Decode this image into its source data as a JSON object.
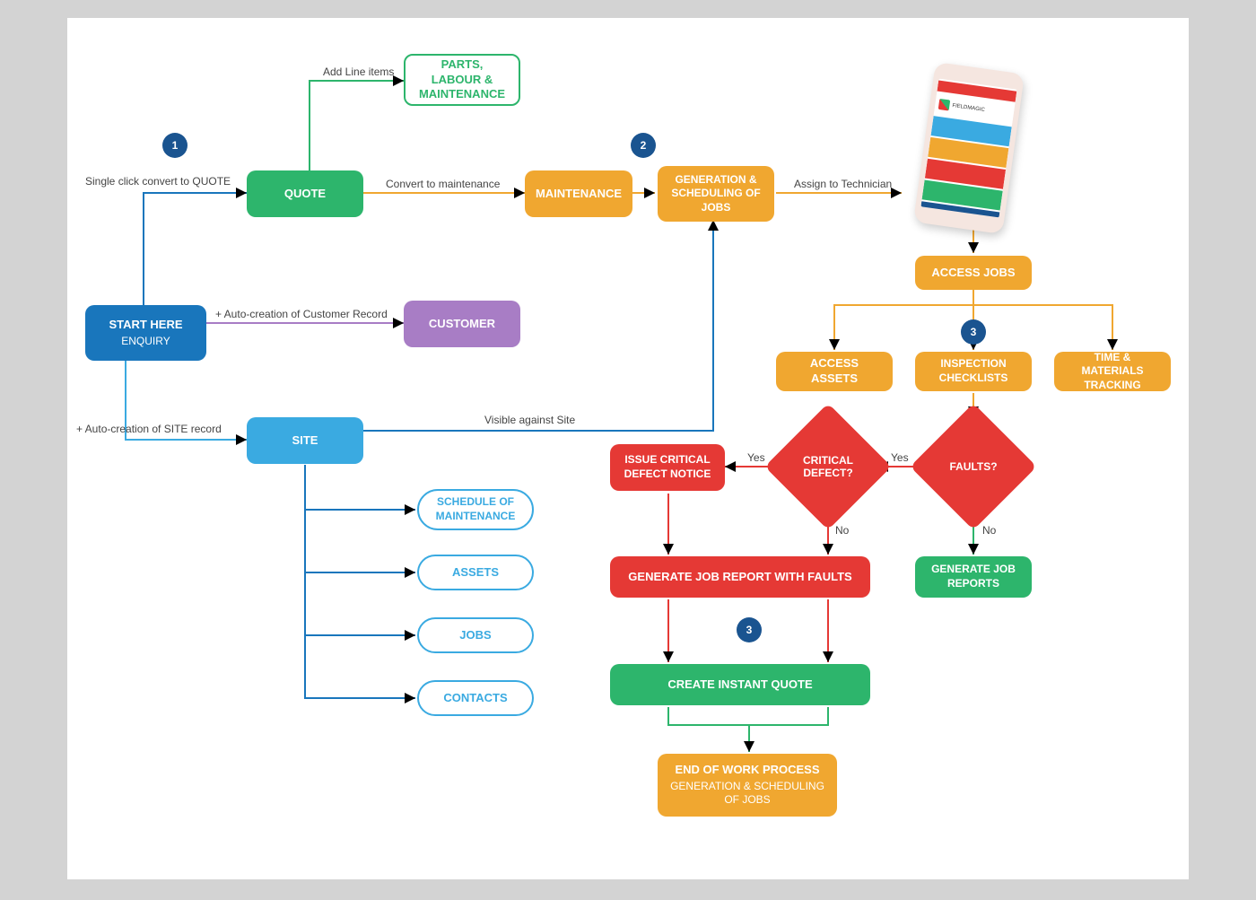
{
  "nodes": {
    "start": {
      "title": "START HERE",
      "subtitle": "ENQUIRY"
    },
    "quote": {
      "title": "QUOTE"
    },
    "parts": {
      "title": "PARTS, LABOUR & MAINTENANCE"
    },
    "maintenance": {
      "title": "MAINTENANCE"
    },
    "generation": {
      "title": "GENERATION & SCHEDULING OF JOBS"
    },
    "customer": {
      "title": "CUSTOMER"
    },
    "site": {
      "title": "SITE"
    },
    "schedule_maintenance": {
      "title": "SCHEDULE OF MAINTENANCE"
    },
    "assets": {
      "title": "ASSETS"
    },
    "jobs": {
      "title": "JOBS"
    },
    "contacts": {
      "title": "CONTACTS"
    },
    "access_jobs": {
      "title": "ACCESS JOBS"
    },
    "access_assets": {
      "title": "ACCESS ASSETS"
    },
    "inspection": {
      "title": "INSPECTION CHECKLISTS"
    },
    "time_materials": {
      "title": "TIME & MATERIALS TRACKING"
    },
    "faults": {
      "title": "FAULTS?"
    },
    "critical_defect": {
      "title": "CRITICAL DEFECT?"
    },
    "issue_notice": {
      "title": "ISSUE CRITICAL DEFECT NOTICE"
    },
    "generate_faults": {
      "title": "GENERATE JOB REPORT WITH FAULTS"
    },
    "generate_reports": {
      "title": "GENERATE JOB REPORTS"
    },
    "create_quote": {
      "title": "CREATE INSTANT QUOTE"
    },
    "end_process": {
      "title": "END OF WORK PROCESS",
      "subtitle": "GENERATION & SCHEDULING OF JOBS"
    }
  },
  "labels": {
    "add_line_items": "Add Line items",
    "convert_quote": "Single click convert to QUOTE",
    "convert_maintenance": "Convert to maintenance",
    "assign_tech": "Assign to Technician",
    "auto_customer": "+ Auto-creation of Customer Record",
    "auto_site": "+ Auto-creation of SITE record",
    "visible_site": "Visible against Site",
    "yes": "Yes",
    "no": "No"
  },
  "badges": {
    "b1": "1",
    "b2": "2",
    "b3": "3",
    "b3b": "3"
  },
  "phone_brand": "FIELDMAGIC"
}
